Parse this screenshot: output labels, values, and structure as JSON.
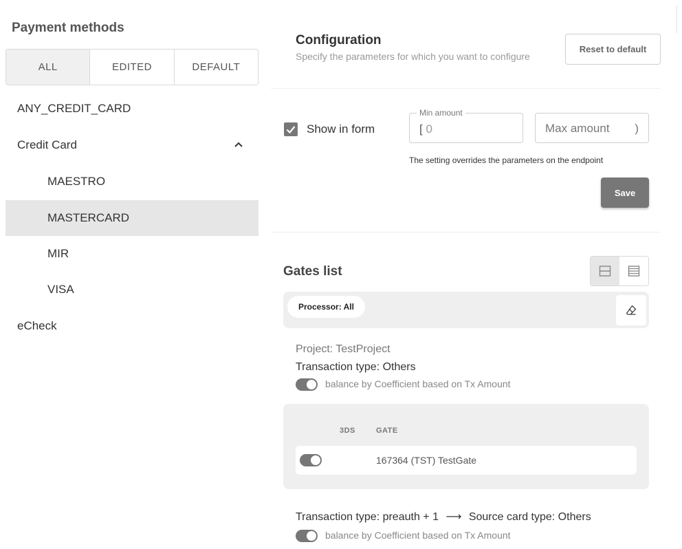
{
  "left": {
    "title": "Payment methods",
    "filters": [
      "ALL",
      "EDITED",
      "DEFAULT"
    ],
    "active_filter": "ALL",
    "tree": [
      {
        "label": "ANY_CREDIT_CARD",
        "level": 0
      },
      {
        "label": "Credit Card",
        "level": 0,
        "expanded": true
      },
      {
        "label": "MAESTRO",
        "level": 1
      },
      {
        "label": "MASTERCARD",
        "level": 1,
        "selected": true
      },
      {
        "label": "MIR",
        "level": 1
      },
      {
        "label": "VISA",
        "level": 1
      },
      {
        "label": "eCheck",
        "level": 0
      }
    ]
  },
  "config": {
    "title": "Configuration",
    "subtitle": "Specify the parameters for which you want to configure",
    "reset_label": "Reset to default",
    "show_in_form_label": "Show in form",
    "show_in_form_checked": true,
    "min_amount_label": "Min amount",
    "min_prefix": "[",
    "min_placeholder": "0",
    "max_placeholder": "Max amount",
    "max_suffix": ")",
    "hint": "The setting overrides the parameters on the endpoint",
    "save_label": "Save"
  },
  "gates": {
    "title": "Gates list",
    "filter_chip": "Processor: All",
    "project": "Project: TestProject",
    "transaction_type": "Transaction type: Others",
    "balance_label": "balance by Coefficient based on Tx Amount",
    "table_headers": [
      "3DS",
      "GATE"
    ],
    "rows": [
      {
        "three_ds_enabled": true,
        "gate": "167364 (TST) TestGate"
      }
    ],
    "transaction_type_2": "Transaction type: preauth + 1",
    "arrow": "⟶",
    "source_card_type": "Source card type: Others",
    "balance_label_2": "balance by Coefficient based on Tx Amount"
  },
  "colors": {
    "accent": "#777777",
    "selected_bg": "#e6e6e6",
    "panel_bg": "#efefef"
  }
}
